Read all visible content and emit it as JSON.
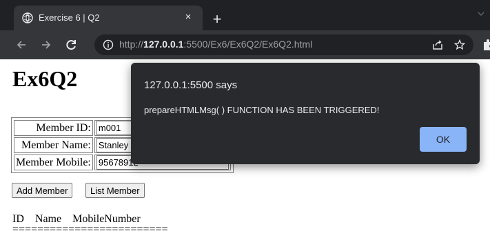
{
  "browser": {
    "tab_title": "Exercise 6 | Q2",
    "tab_close": "×",
    "new_tab": "+",
    "url_prefix": "http://",
    "url_host": "127.0.0.1",
    "url_rest": ":5500/Ex6/Ex6Q2/Ex6Q2.html",
    "icons": [
      "favicon-globe-icon",
      "back-arrow-icon",
      "forward-arrow-icon",
      "reload-icon",
      "site-info-icon",
      "share-icon",
      "bookmark-star-icon",
      "extensions-puzzle-icon",
      "tab-search-icon"
    ]
  },
  "page": {
    "heading": "Ex6Q2",
    "form": {
      "member_id_label": "Member ID:",
      "member_id_value": "m001",
      "member_name_label": "Member Name:",
      "member_name_value": "Stanley",
      "member_mobile_label": "Member Mobile:",
      "member_mobile_value": "95678912"
    },
    "add_button": "Add Member",
    "list_button": "List Member",
    "list_header": "ID    Name    MobileNumber",
    "list_separator": "========================="
  },
  "dialog": {
    "title": "127.0.0.1:5500 says",
    "message": "prepareHTMLMsg( ) FUNCTION HAS BEEN TRIGGERED!",
    "ok_label": "OK"
  },
  "colors": {
    "chrome_dark": "#202124",
    "toolbar": "#35363a",
    "dialog_bg": "#292a2d",
    "ok_button": "#8ab4f8"
  }
}
